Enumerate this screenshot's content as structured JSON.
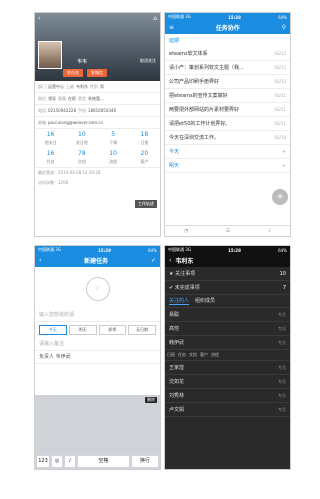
{
  "status": {
    "carrier": "中国联通 3G",
    "time": "15:28",
    "time2": "15:29",
    "battery": "64%"
  },
  "p1": {
    "name": "韦韦",
    "unfollow": "取消关注",
    "btn_task": "发任务",
    "btn_msg": "发微信",
    "rows": [
      [
        "部门",
        "运营中心",
        "上级",
        "韦利东",
        "性别",
        "男"
      ],
      [
        "岗位",
        "领导",
        "直属",
        "在职",
        "类型",
        "系统管..."
      ],
      [
        "电话",
        "02150942228",
        "手机",
        "18616650346",
        "",
        ""
      ]
    ],
    "email_label": "邮箱",
    "email": "paul.xiong@weaver.com.cn",
    "stats": [
      {
        "n": "16",
        "l": "他关注"
      },
      {
        "n": "10",
        "l": "关注他"
      },
      {
        "n": "5",
        "l": "下属"
      },
      {
        "n": "18",
        "l": "日报"
      },
      {
        "n": "16",
        "l": "任务"
      },
      {
        "n": "78",
        "l": "文档"
      },
      {
        "n": "10",
        "l": "流程"
      },
      {
        "n": "20",
        "l": "客户"
      }
    ],
    "last_login": "最近登录：2014-03-28 14:20:28",
    "visits": "访问次数：1206",
    "track": "工作轨迹"
  },
  "p2": {
    "title": "任务协作",
    "section1": "延期",
    "items": [
      {
        "t": "eteams软文体系",
        "d": "03/12"
      },
      {
        "t": "请小产：策划系列软文主题（我...",
        "d": "03/12"
      },
      {
        "t": "公司产品印刷手册弄好",
        "d": "03/12"
      },
      {
        "t": "把eteams的宣传文案做好",
        "d": "03/11"
      },
      {
        "t": "两要把外部网站的片素材要弄好",
        "d": "03/11"
      },
      {
        "t": "请把et50的工作计划弄好。",
        "d": "03/11"
      },
      {
        "t": "今天在深圳交流工作。",
        "d": "03/10"
      }
    ],
    "section2": "今天",
    "section3": "明天"
  },
  "p3": {
    "title": "新建任务",
    "placeholder": "输入您想说的话",
    "chips": [
      "今天",
      "明天",
      "即将",
      "无日期"
    ],
    "note_placeholder": "请输入备注",
    "owner_label": "负责人",
    "owner": "韦伊武",
    "kbd_num": "123",
    "kbd_space": "空格",
    "kbd_return": "换行",
    "del": "删除"
  },
  "p4": {
    "title": "韦利东",
    "followed": "关注事项",
    "followed_n": "10",
    "unfinished": "未完成事项",
    "unfinished_n": "7",
    "tab_a": "关注的人",
    "tab_b": "组织成员",
    "people": [
      {
        "n": "易聪",
        "g": "专员"
      },
      {
        "n": "高恺",
        "g": "专员"
      },
      {
        "n": "韩伊武",
        "g": "专员"
      },
      {
        "n": "王家煌",
        "g": "专员"
      },
      {
        "n": "沈如龙",
        "g": "专员"
      },
      {
        "n": "刘秀林",
        "g": "专员"
      },
      {
        "n": "卢文娟",
        "g": "专员"
      }
    ],
    "ops": [
      "日报",
      "任务",
      "文档",
      "客户",
      "流程"
    ]
  }
}
